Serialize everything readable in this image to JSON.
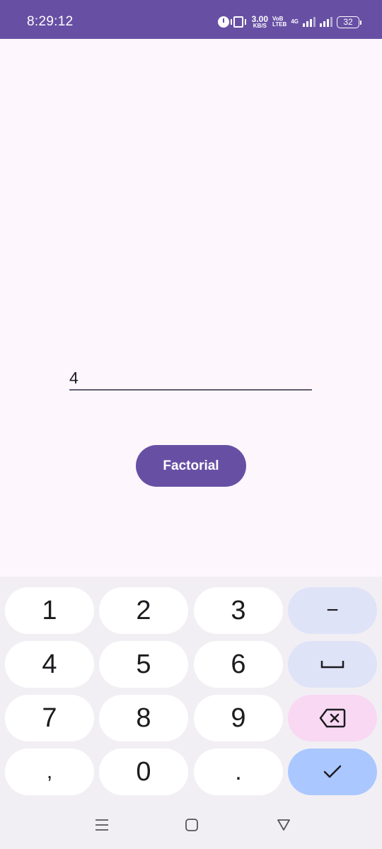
{
  "status_bar": {
    "time": "8:29:12",
    "speed_value": "3.00",
    "speed_unit": "KB/S",
    "volte_top": "VoB",
    "volte_bottom": "LTEB",
    "network": "4G",
    "battery": "32"
  },
  "main": {
    "input_value": "4",
    "button_label": "Factorial"
  },
  "keyboard": {
    "keys": [
      "1",
      "2",
      "3",
      "4",
      "5",
      "6",
      "7",
      "8",
      "9",
      ",",
      "0",
      "."
    ],
    "minus": "−"
  },
  "colors": {
    "primary": "#6750a4",
    "background": "#fdf7fd",
    "keyboard_bg": "#f2eff4",
    "fn_key": "#dfe3f8",
    "delete_key": "#f8d8f3",
    "done_key": "#aac7ff"
  },
  "icons": {
    "alarm": "alarm-icon",
    "vibrate": "vibrate-icon",
    "signal": "signal-icon",
    "battery": "battery-icon",
    "space": "space-icon",
    "backspace": "backspace-icon",
    "done": "check-icon",
    "recents": "menu-icon",
    "home": "home-icon",
    "back": "back-icon"
  }
}
